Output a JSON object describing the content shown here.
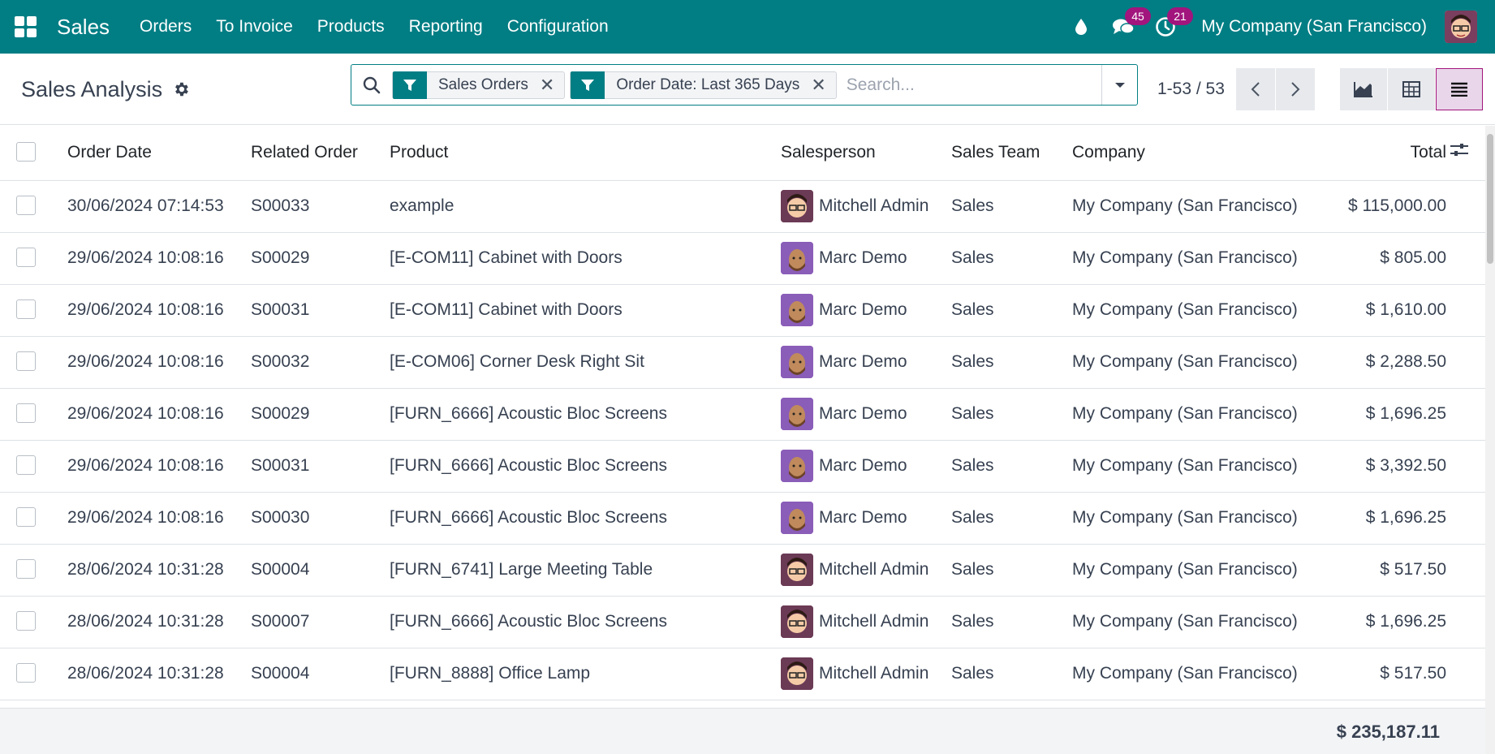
{
  "topbar": {
    "app_name": "Sales",
    "menu": [
      "Orders",
      "To Invoice",
      "Products",
      "Reporting",
      "Configuration"
    ],
    "messages_badge": "45",
    "activities_badge": "21",
    "company": "My Company (San Francisco)"
  },
  "control_panel": {
    "title": "Sales Analysis",
    "facets": [
      "Sales Orders",
      "Order Date: Last 365 Days"
    ],
    "search_placeholder": "Search...",
    "pager": "1-53 / 53"
  },
  "table": {
    "headers": {
      "order_date": "Order Date",
      "related_order": "Related Order",
      "product": "Product",
      "salesperson": "Salesperson",
      "sales_team": "Sales Team",
      "company": "Company",
      "total": "Total"
    },
    "rows": [
      {
        "date": "30/06/2024 07:14:53",
        "order": "S00033",
        "product": "example",
        "salesperson": "Mitchell Admin",
        "team": "Sales",
        "company": "My Company (San Francisco)",
        "total": "$ 115,000.00"
      },
      {
        "date": "29/06/2024 10:08:16",
        "order": "S00029",
        "product": "[E-COM11] Cabinet with Doors",
        "salesperson": "Marc Demo",
        "team": "Sales",
        "company": "My Company (San Francisco)",
        "total": "$ 805.00"
      },
      {
        "date": "29/06/2024 10:08:16",
        "order": "S00031",
        "product": "[E-COM11] Cabinet with Doors",
        "salesperson": "Marc Demo",
        "team": "Sales",
        "company": "My Company (San Francisco)",
        "total": "$ 1,610.00"
      },
      {
        "date": "29/06/2024 10:08:16",
        "order": "S00032",
        "product": "[E-COM06] Corner Desk Right Sit",
        "salesperson": "Marc Demo",
        "team": "Sales",
        "company": "My Company (San Francisco)",
        "total": "$ 2,288.50"
      },
      {
        "date": "29/06/2024 10:08:16",
        "order": "S00029",
        "product": "[FURN_6666] Acoustic Bloc Screens",
        "salesperson": "Marc Demo",
        "team": "Sales",
        "company": "My Company (San Francisco)",
        "total": "$ 1,696.25"
      },
      {
        "date": "29/06/2024 10:08:16",
        "order": "S00031",
        "product": "[FURN_6666] Acoustic Bloc Screens",
        "salesperson": "Marc Demo",
        "team": "Sales",
        "company": "My Company (San Francisco)",
        "total": "$ 3,392.50"
      },
      {
        "date": "29/06/2024 10:08:16",
        "order": "S00030",
        "product": "[FURN_6666] Acoustic Bloc Screens",
        "salesperson": "Marc Demo",
        "team": "Sales",
        "company": "My Company (San Francisco)",
        "total": "$ 1,696.25"
      },
      {
        "date": "28/06/2024 10:31:28",
        "order": "S00004",
        "product": "[FURN_6741] Large Meeting Table",
        "salesperson": "Mitchell Admin",
        "team": "Sales",
        "company": "My Company (San Francisco)",
        "total": "$ 517.50"
      },
      {
        "date": "28/06/2024 10:31:28",
        "order": "S00007",
        "product": "[FURN_6666] Acoustic Bloc Screens",
        "salesperson": "Mitchell Admin",
        "team": "Sales",
        "company": "My Company (San Francisco)",
        "total": "$ 1,696.25"
      },
      {
        "date": "28/06/2024 10:31:28",
        "order": "S00004",
        "product": "[FURN_8888] Office Lamp",
        "salesperson": "Mitchell Admin",
        "team": "Sales",
        "company": "My Company (San Francisco)",
        "total": "$ 517.50"
      }
    ],
    "grand_total": "$ 235,187.11"
  },
  "colors": {
    "brand": "#017e84",
    "badge": "#a1157d",
    "active_view": "#e9d6ea"
  }
}
